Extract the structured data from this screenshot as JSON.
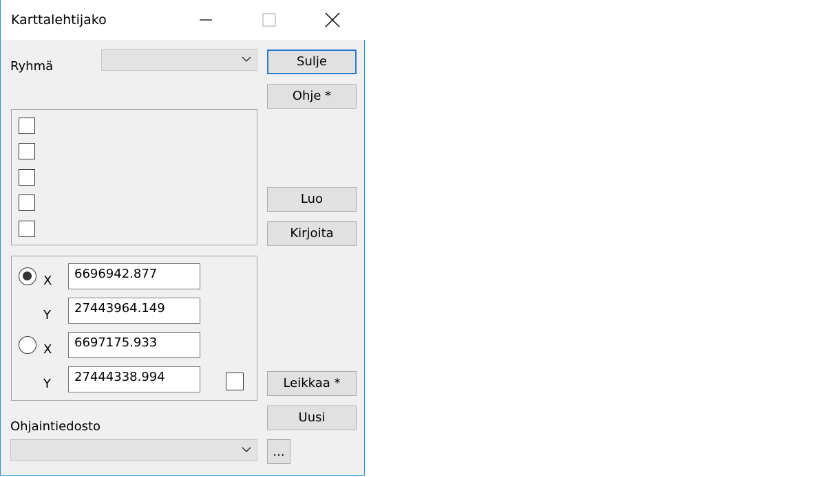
{
  "window": {
    "title": "Karttalehtijako"
  },
  "group_label": "Ryhmä",
  "group_select": {
    "value": ""
  },
  "buttons": {
    "sulje": "Sulje",
    "ohje": "Ohje *",
    "luo": "Luo",
    "kirjoita": "Kirjoita",
    "leikkaa": "Leikkaa *",
    "uusi": "Uusi",
    "browse": "..."
  },
  "layers": [
    {
      "checked": false
    },
    {
      "checked": false
    },
    {
      "checked": false
    },
    {
      "checked": false
    },
    {
      "checked": false
    }
  ],
  "coords": {
    "x_label": "X",
    "y_label": "Y",
    "point1": {
      "selected": true,
      "x": "6696942.877",
      "y": "27443964.149"
    },
    "point2": {
      "selected": false,
      "x": "6697175.933",
      "y": "27444338.994"
    },
    "extra_checkbox": false
  },
  "control_file": {
    "label": "Ohjaintiedosto",
    "value": ""
  }
}
